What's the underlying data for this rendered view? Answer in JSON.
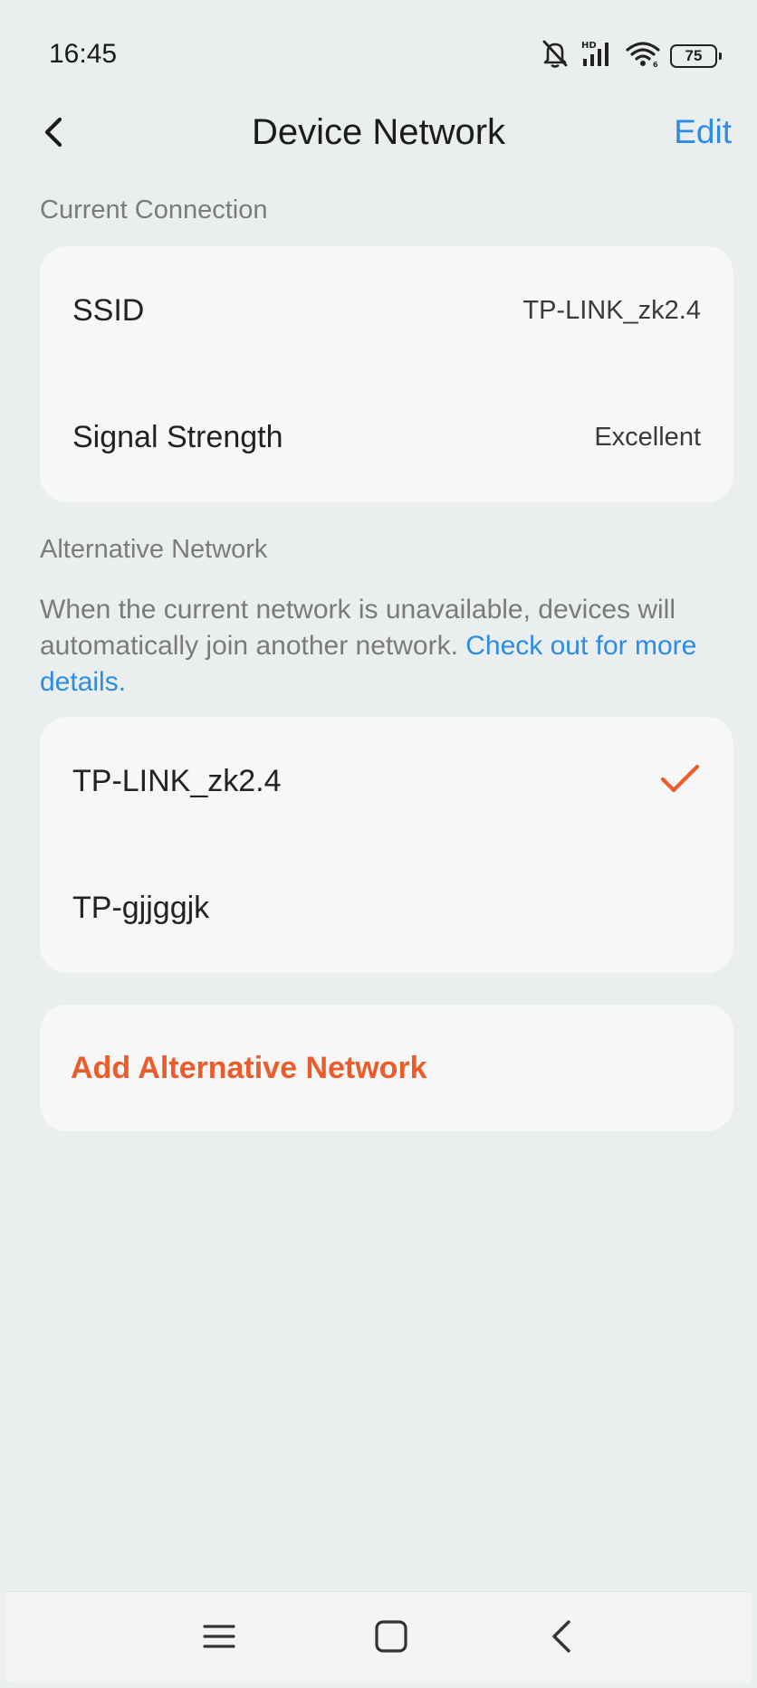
{
  "status_bar": {
    "time": "16:45",
    "battery": "75",
    "icons": [
      "muted-bell-icon",
      "hd-signal-icon",
      "wifi-icon",
      "battery-icon"
    ]
  },
  "header": {
    "title": "Device Network",
    "edit_label": "Edit",
    "back_icon": "chevron-left-icon"
  },
  "current_connection": {
    "section_label": "Current Connection",
    "rows": [
      {
        "label": "SSID",
        "value": "TP-LINK_zk2.4"
      },
      {
        "label": "Signal Strength",
        "value": "Excellent"
      }
    ]
  },
  "alternative_network": {
    "section_label": "Alternative Network",
    "description": "When the current network is unavailable, devices will automatically join another network. ",
    "link_text": "Check out for more details.",
    "networks": [
      {
        "name": "TP-LINK_zk2.4",
        "selected": true
      },
      {
        "name": "TP-gjjggjk",
        "selected": false
      }
    ],
    "add_label": "Add Alternative Network"
  },
  "colors": {
    "accent_blue": "#2c8ce6",
    "accent_orange": "#ec5b2a",
    "background": "#ebeeef",
    "card": "#f7f7f7"
  },
  "nav_bar": {
    "icons": [
      "menu-icon",
      "home-square-icon",
      "back-triangle-icon"
    ]
  }
}
